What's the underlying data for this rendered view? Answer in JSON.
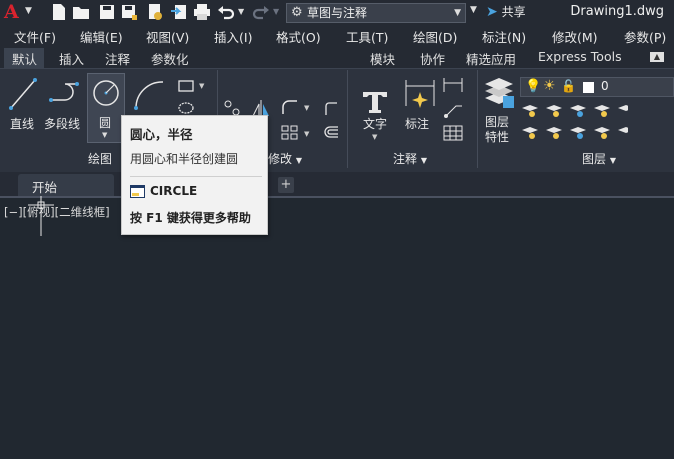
{
  "app": {
    "logo_letter": "A",
    "workspace": "草图与注释",
    "share_label": "共享",
    "filename": "Drawing1.dwg"
  },
  "menu": [
    "文件(F)",
    "编辑(E)",
    "视图(V)",
    "插入(I)",
    "格式(O)",
    "工具(T)",
    "绘图(D)",
    "标注(N)",
    "修改(M)",
    "参数(P)"
  ],
  "tabs": [
    "默认",
    "插入",
    "注释",
    "参数化",
    "模块",
    "协作",
    "精选应用",
    "Express Tools"
  ],
  "ribbon": {
    "draw": {
      "line": "直线",
      "polyline": "多段线",
      "circle": "圆",
      "panel_title": "绘图"
    },
    "modify": {
      "panel_title": "修改"
    },
    "annotation": {
      "text": "文字",
      "dimension": "标注",
      "panel_title": "注释"
    },
    "layers": {
      "layer_props": "图层\n特性",
      "layer_value": "0",
      "panel_title": "图层"
    }
  },
  "doc_tab": {
    "start": "开始"
  },
  "viewport_label": "[−][俯视][二维线框]",
  "tooltip": {
    "title": "圆心，半径",
    "desc": "用圆心和半径创建圆",
    "command": "CIRCLE",
    "help": "按 F1 键获得更多帮助"
  },
  "colors": {
    "background": "#212830",
    "ribbon": "#2d333e",
    "logo": "#d9232e",
    "accent": "#4aa3df"
  }
}
